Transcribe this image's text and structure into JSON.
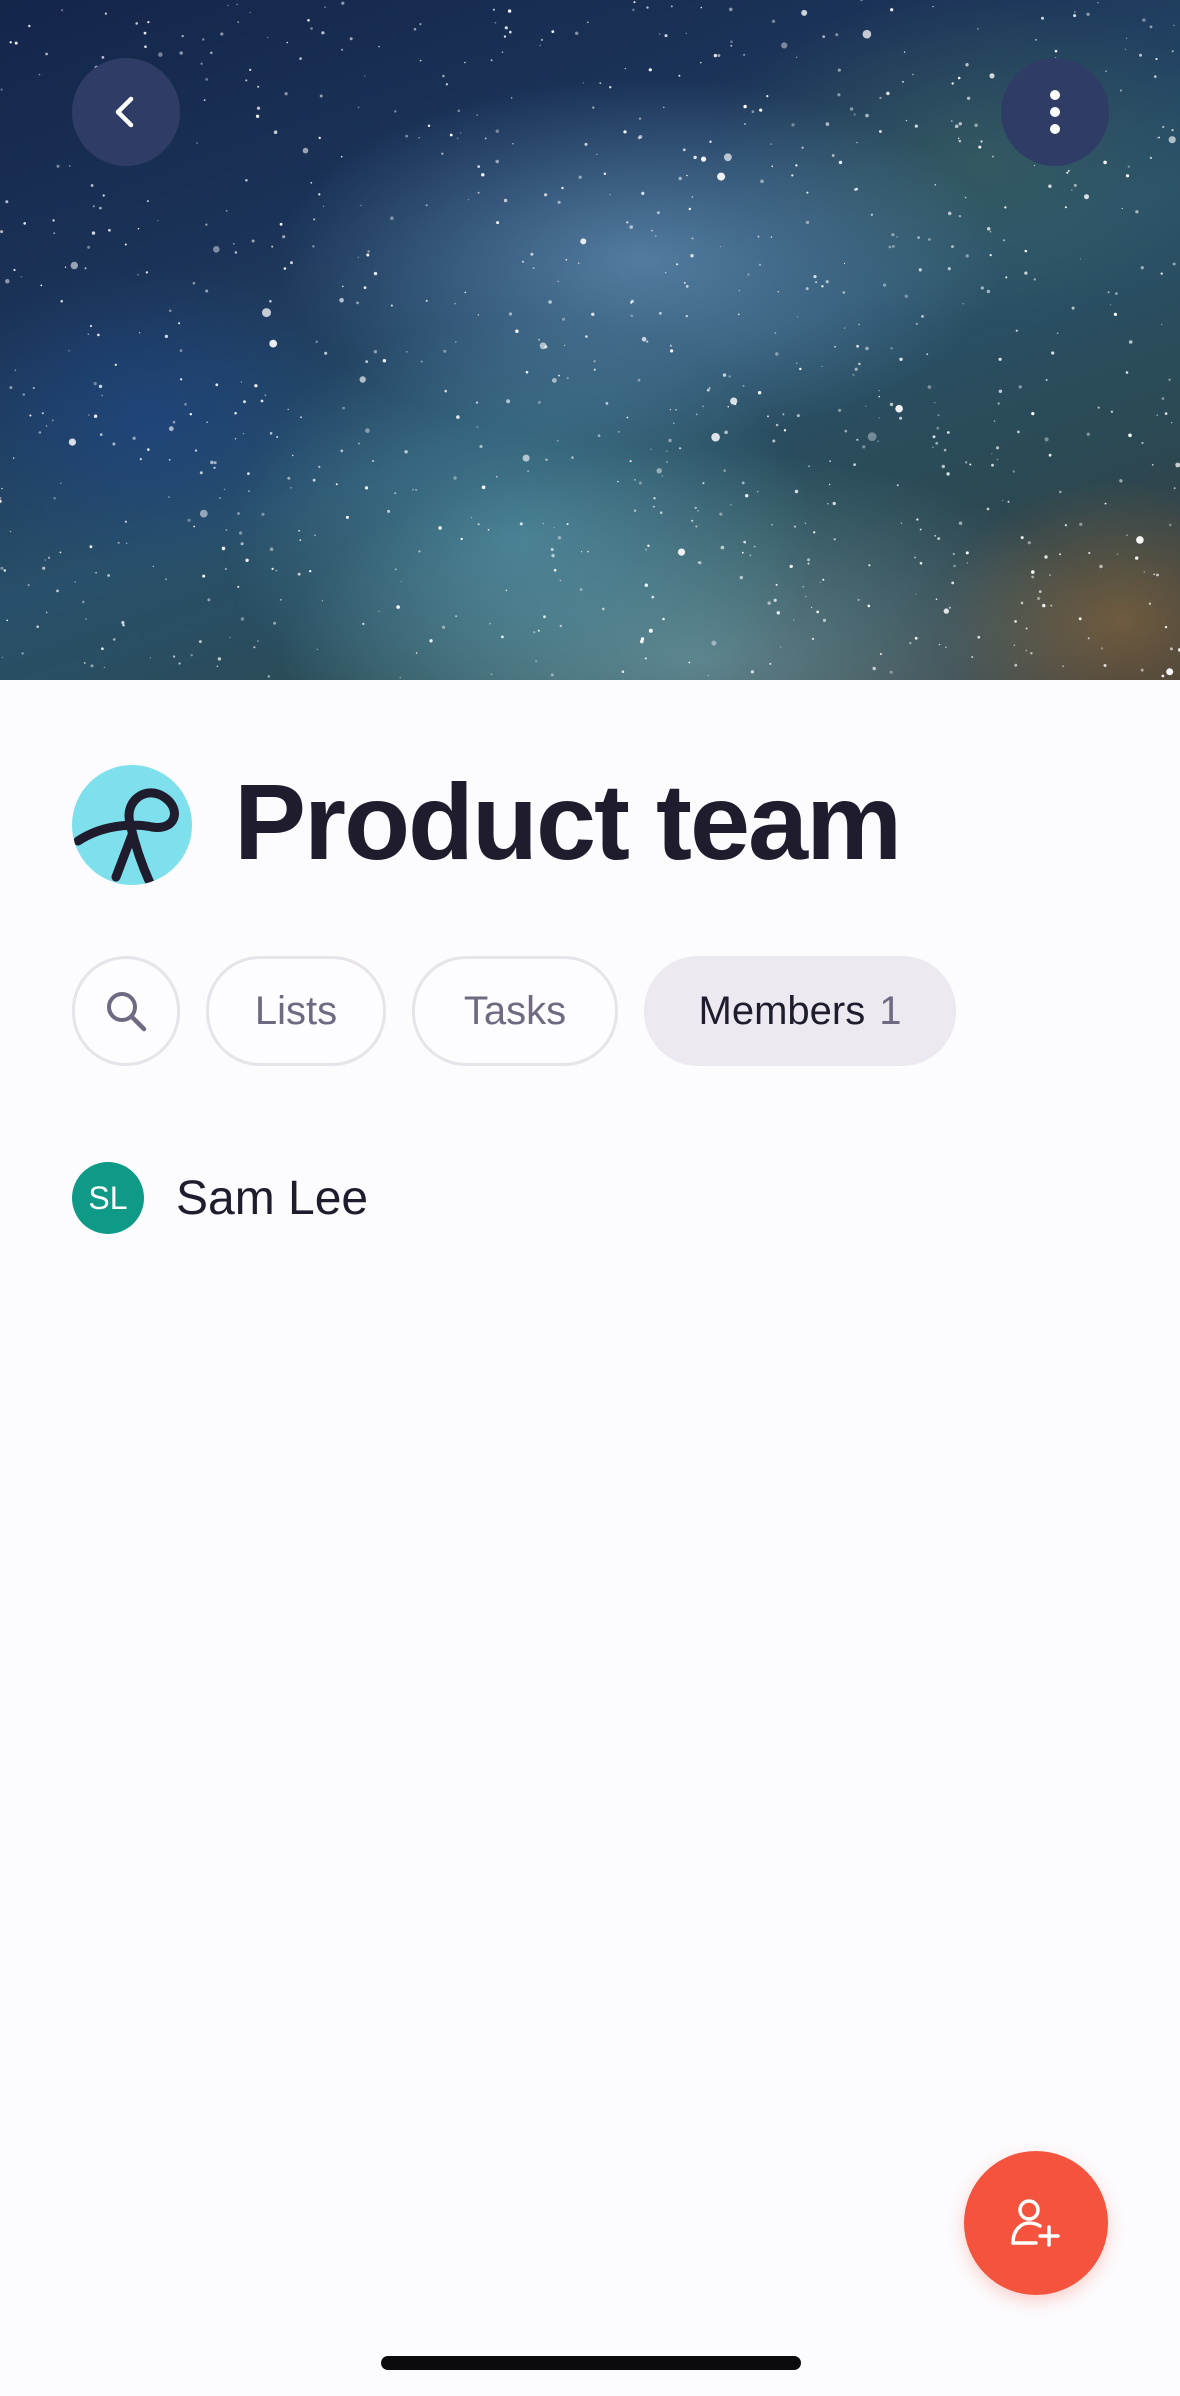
{
  "colors": {
    "background": "#fcfbfd",
    "accent_fab": "#f4533d",
    "avatar": "#0e9a87",
    "team_logo": "#7ee0ec",
    "header_button": "#2f3d66"
  },
  "header": {
    "back_icon": "chevron-left-icon",
    "more_icon": "vertical-dots-icon"
  },
  "team": {
    "logo_icon": "ribbon-loop-icon",
    "name": "Product team"
  },
  "tabs": {
    "search_icon": "search-icon",
    "items": [
      {
        "label": "Lists",
        "selected": false
      },
      {
        "label": "Tasks",
        "selected": false
      },
      {
        "label": "Members",
        "count": "1",
        "selected": true
      }
    ]
  },
  "members": [
    {
      "initials": "SL",
      "name": "Sam Lee"
    }
  ],
  "fab": {
    "icon": "add-person-icon"
  }
}
